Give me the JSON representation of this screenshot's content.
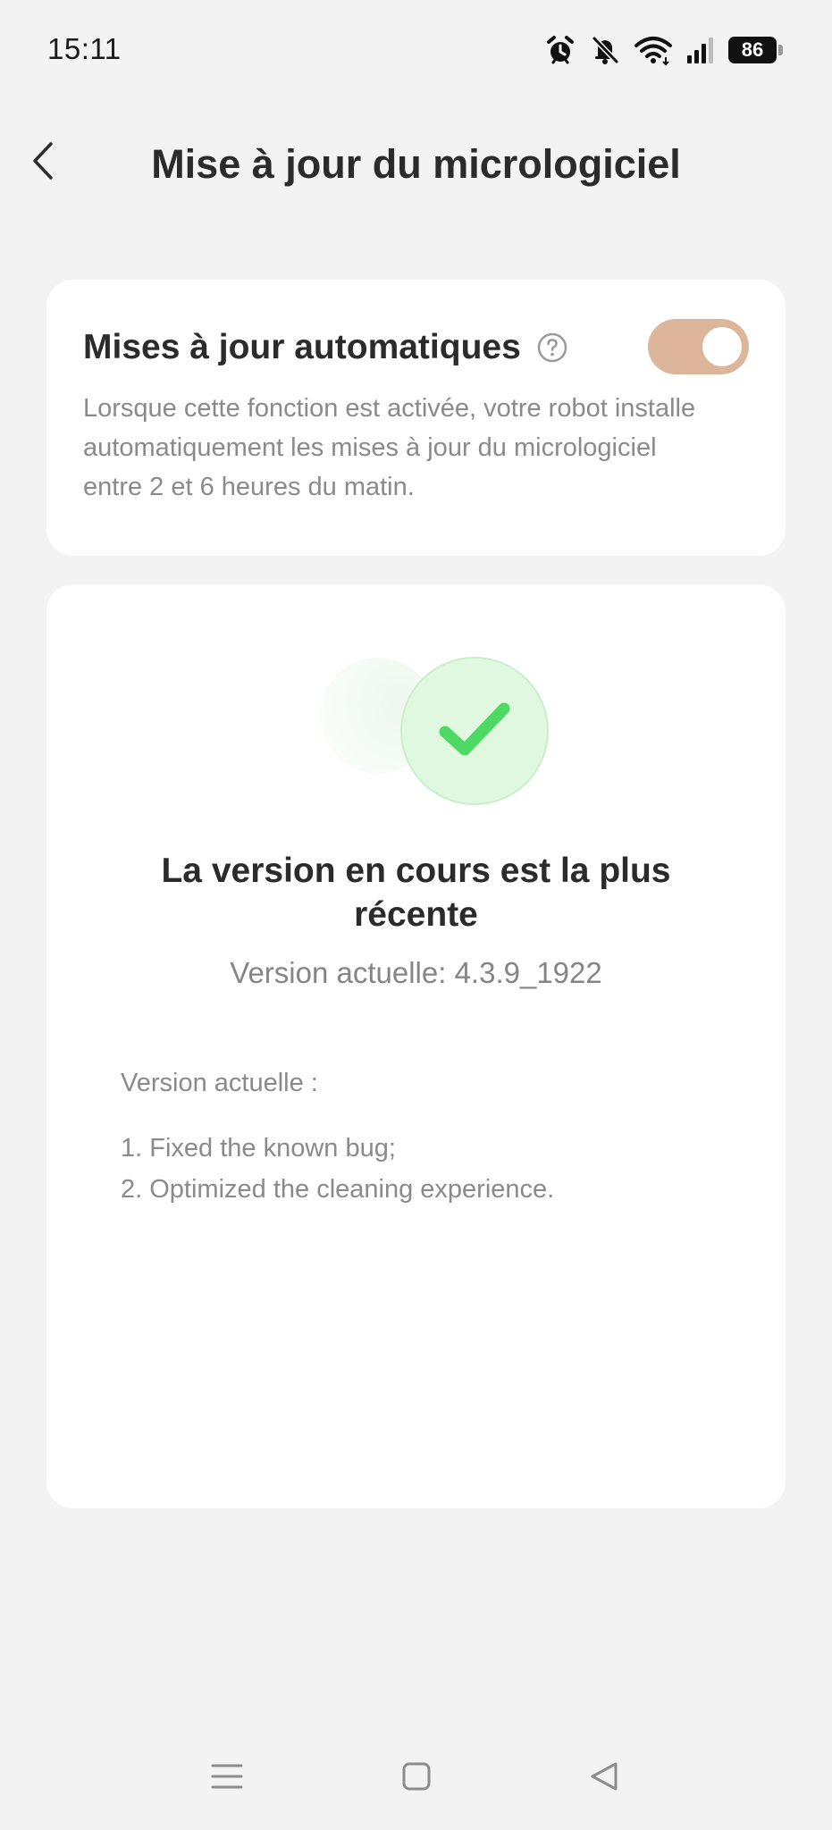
{
  "status_bar": {
    "time": "15:11",
    "battery_level": "86",
    "icons": [
      "alarm-icon",
      "bell-off-icon",
      "wifi-icon",
      "signal-icon",
      "battery-icon"
    ]
  },
  "header": {
    "title": "Mise à jour du micrologiciel",
    "back_icon": "chevron-left-icon"
  },
  "auto_updates": {
    "title": "Mises à jour automatiques",
    "help_icon": "question-circle-icon",
    "enabled": true,
    "toggle_color": "#dcb59b",
    "description": "Lorsque cette fonction est activée, votre robot installe automatiquement les mises à jour du micrologiciel entre 2 et 6 heures du matin."
  },
  "firmware_status": {
    "icon": "check-circle-icon",
    "check_color": "#4cd964",
    "title": "La version en cours est la plus récente",
    "current_version": "Version actuelle: 4.3.9_1922",
    "notes_heading": "Version actuelle :",
    "notes": [
      "1. Fixed the known bug;",
      "2. Optimized the cleaning experience."
    ]
  },
  "nav_bar": {
    "icons": [
      "menu-icon",
      "home-square-icon",
      "back-triangle-icon"
    ]
  }
}
